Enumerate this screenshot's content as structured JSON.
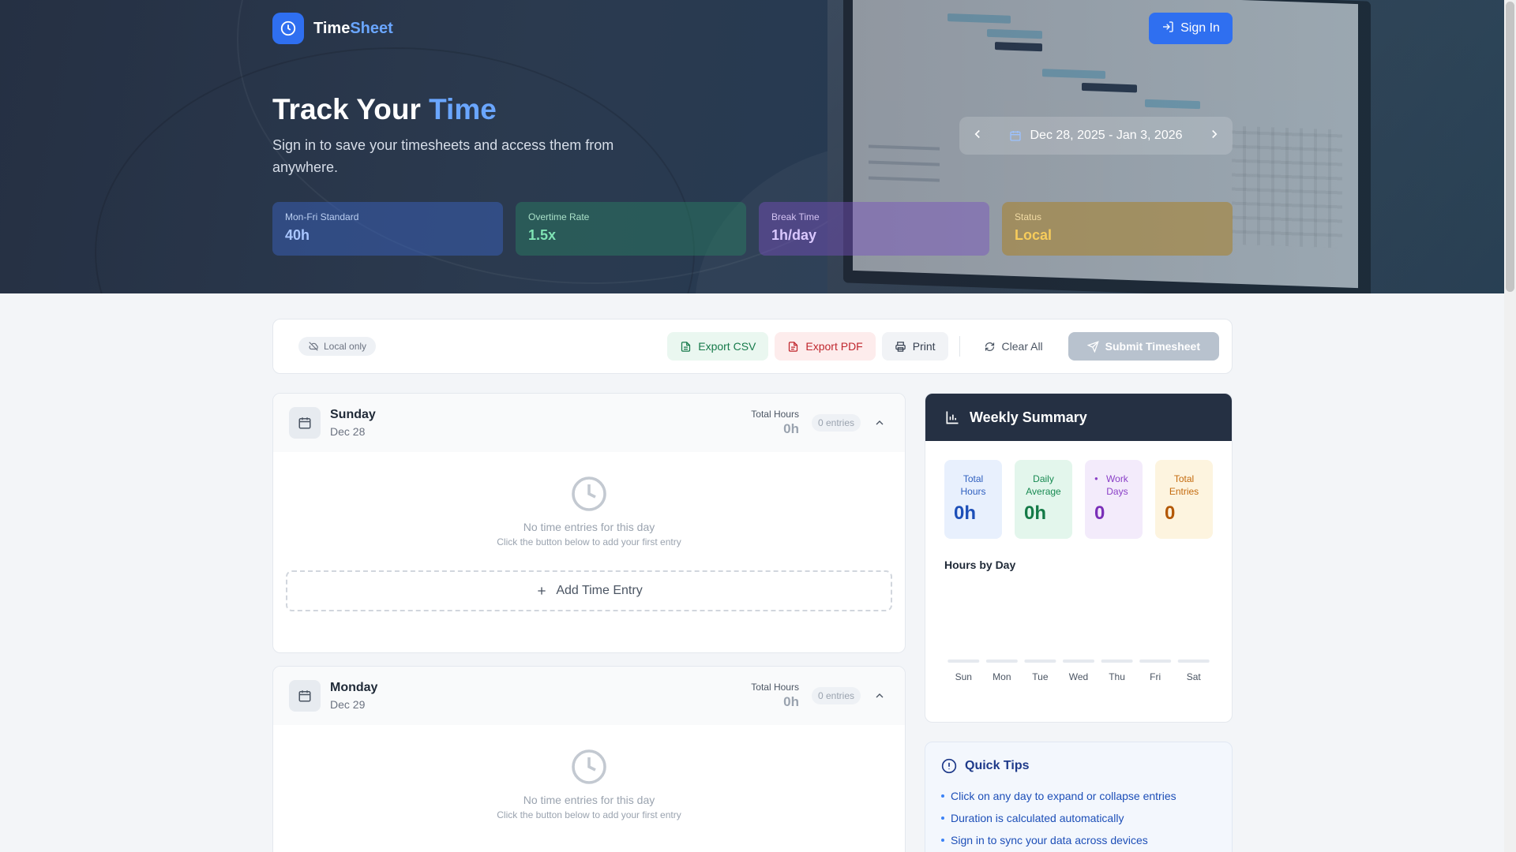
{
  "brand": {
    "name_primary": "Time",
    "name_accent": "Sheet"
  },
  "header": {
    "signin_label": "Sign In"
  },
  "hero": {
    "title_primary": "Track Your",
    "title_accent": "Time",
    "subtitle": "Sign in to save your timesheets and access them from anywhere.",
    "date_range": "Dec 28, 2025 - Jan 3, 2026"
  },
  "stats": [
    {
      "label": "Mon-Fri Standard",
      "value": "40h"
    },
    {
      "label": "Overtime Rate",
      "value": "1.5x"
    },
    {
      "label": "Break Time",
      "value": "1h/day"
    },
    {
      "label": "Status",
      "value": "Local"
    }
  ],
  "toolbar": {
    "local_only": "Local only",
    "export_csv": "Export CSV",
    "export_pdf": "Export PDF",
    "print": "Print",
    "clear_all": "Clear All",
    "submit": "Submit Timesheet"
  },
  "days": [
    {
      "name": "Sunday",
      "date": "Dec 28",
      "total_label": "Total Hours",
      "total": "0h",
      "entries": "0 entries",
      "empty_title": "No time entries for this day",
      "empty_sub": "Click the button below to add your first entry",
      "add_label": "Add Time Entry"
    },
    {
      "name": "Monday",
      "date": "Dec 29",
      "total_label": "Total Hours",
      "total": "0h",
      "entries": "0 entries",
      "empty_title": "No time entries for this day",
      "empty_sub": "Click the button below to add your first entry"
    }
  ],
  "summary": {
    "title": "Weekly Summary",
    "stats": [
      {
        "label": "Total Hours",
        "value": "0h"
      },
      {
        "label": "Daily Average",
        "value": "0h"
      },
      {
        "label": "Work Days",
        "value": "0"
      },
      {
        "label": "Total Entries",
        "value": "0"
      }
    ],
    "chart_title": "Hours by Day"
  },
  "chart_data": {
    "type": "bar",
    "title": "Hours by Day",
    "categories": [
      "Sun",
      "Mon",
      "Tue",
      "Wed",
      "Thu",
      "Fri",
      "Sat"
    ],
    "values": [
      0,
      0,
      0,
      0,
      0,
      0,
      0
    ],
    "xlabel": "",
    "ylabel": ""
  },
  "tips": {
    "title": "Quick Tips",
    "items": [
      "Click on any day to expand or collapse entries",
      "Duration is calculated automatically",
      "Sign in to sync your data across devices"
    ]
  },
  "colors": {
    "accent": "#2f6ff0",
    "header_dark": "#253043"
  }
}
